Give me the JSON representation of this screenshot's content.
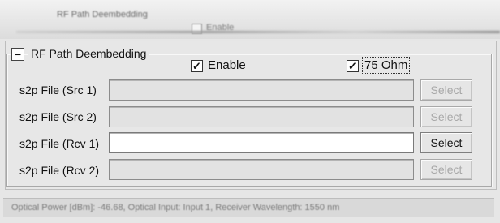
{
  "header": {
    "ghost_title": "RF Path Deembedding",
    "ghost_enable": "Enable"
  },
  "group": {
    "title": "RF Path Deembedding",
    "collapse_symbol": "−"
  },
  "options": {
    "enable": {
      "label": "Enable",
      "checked": "✓"
    },
    "ohm75": {
      "label": "75 Ohm",
      "checked": "✓"
    }
  },
  "rows": [
    {
      "label": "s2p File (Src 1)",
      "button": "Select"
    },
    {
      "label": "s2p File (Src 2)",
      "button": "Select"
    },
    {
      "label": "s2p File (Rcv 1)",
      "button": "Select"
    },
    {
      "label": "s2p File (Rcv 2)",
      "button": "Select"
    }
  ],
  "status": {
    "text": "Optical Power [dBm]:  -46.68,  Optical Input:  Input 1,  Receiver Wavelength:  1550 nm"
  }
}
